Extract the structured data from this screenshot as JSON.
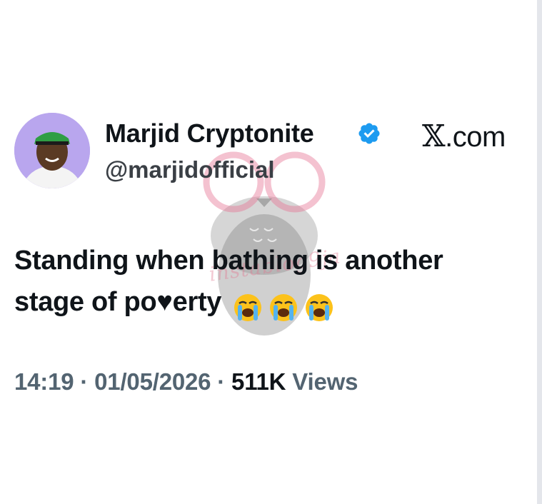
{
  "tweet": {
    "author_name": "Marjid Cryptonite",
    "handle": "@marjidofficial",
    "source": ".com",
    "text_line1": "Standing when bathing is another",
    "text_line2": "stage of po♥erty",
    "emojis": [
      "loudly-crying-face",
      "loudly-crying-face",
      "loudly-crying-face"
    ],
    "time": "14:19",
    "separator": "·",
    "date": "01/05/2026",
    "views_count": "511K",
    "views_label": "Views"
  },
  "watermark": {
    "text": "instablog9ja"
  },
  "colors": {
    "verified_blue": "#1d9bf0",
    "meta_gray": "#536471",
    "text_dark": "#0f1419"
  }
}
